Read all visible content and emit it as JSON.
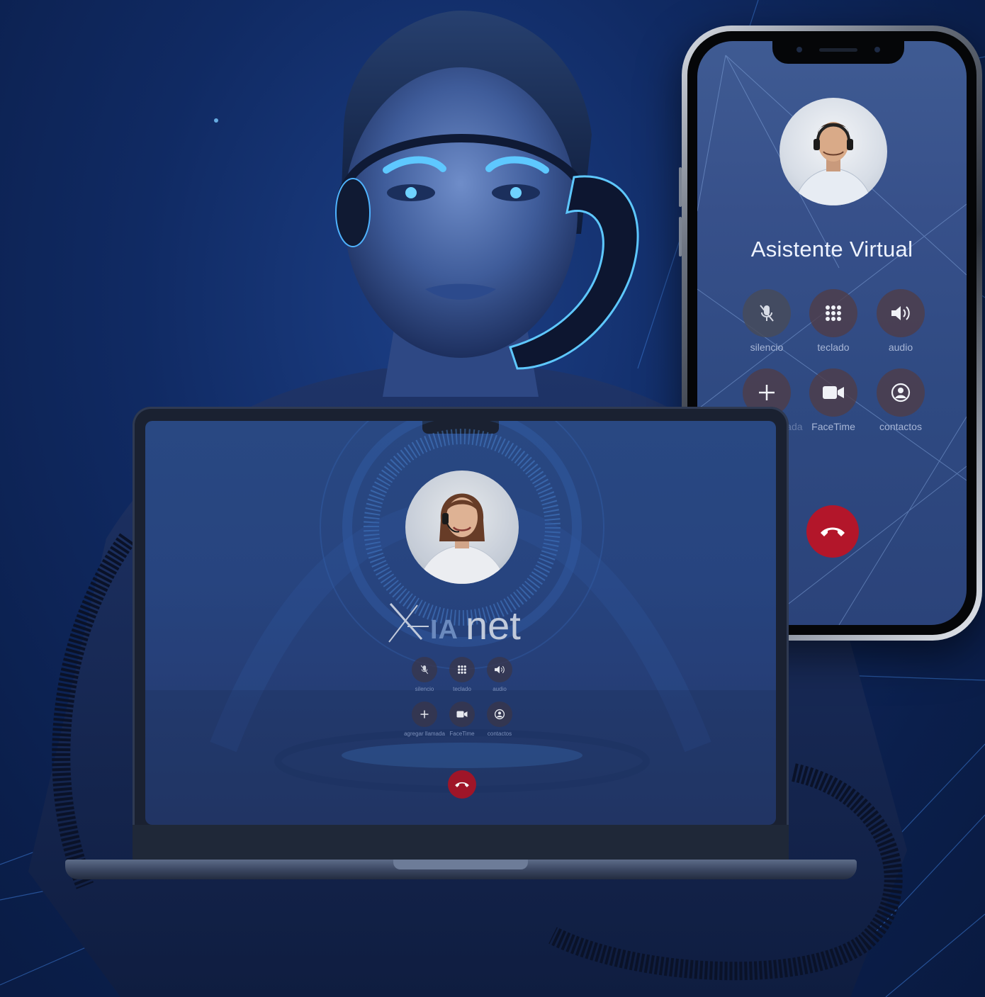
{
  "phone": {
    "contact_name": "Asistente Virtual",
    "buttons": [
      {
        "label": "silencio",
        "icon": "mic-off-icon"
      },
      {
        "label": "teclado",
        "icon": "keypad-icon"
      },
      {
        "label": "audio",
        "icon": "speaker-icon"
      },
      {
        "label": "agregar llamada",
        "icon": "plus-icon"
      },
      {
        "label": "FaceTime",
        "icon": "video-icon"
      },
      {
        "label": "contactos",
        "icon": "contact-icon"
      }
    ],
    "end_call_icon": "hangup-icon",
    "end_call_color": "#b3162a"
  },
  "laptop": {
    "logo": {
      "ia": "IA",
      "net": "net"
    },
    "buttons": [
      {
        "label": "silencio",
        "icon": "mic-off-icon"
      },
      {
        "label": "teclado",
        "icon": "keypad-icon"
      },
      {
        "label": "audio",
        "icon": "speaker-icon"
      },
      {
        "label": "agregar llamada",
        "icon": "plus-icon"
      },
      {
        "label": "FaceTime",
        "icon": "video-icon"
      },
      {
        "label": "contactos",
        "icon": "contact-icon"
      }
    ],
    "end_call_icon": "hangup-icon",
    "end_call_color": "#a51528"
  },
  "colors": {
    "background": "#102a63",
    "accent_glow": "#5ec8ff",
    "end_call": "#b3162a"
  }
}
